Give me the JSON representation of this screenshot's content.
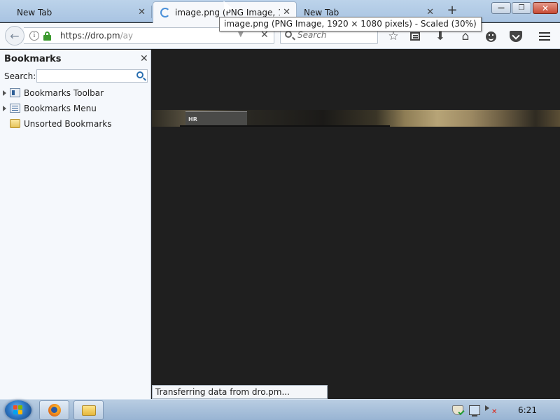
{
  "tabs": [
    {
      "label": "New Tab",
      "active": false
    },
    {
      "label": "image.png (PNG Image, 1...",
      "active": true,
      "loading": true
    },
    {
      "label": "New Tab",
      "active": false
    }
  ],
  "tab_close_glyph": "✕",
  "new_tab_glyph": "+",
  "window_controls": {
    "minimize": "—",
    "maximize": "❐",
    "close": "✕"
  },
  "tooltip": "image.png (PNG Image, 1920 × 1080 pixels) - Scaled (30%)",
  "navbar": {
    "url_host": "https://dro.pm",
    "url_path": "/ay",
    "search_placeholder": "Search",
    "back_glyph": "←",
    "stop_glyph": "✕",
    "dropdown_glyph": "▼",
    "star_glyph": "☆",
    "download_glyph": "⬇",
    "home_glyph": "⌂"
  },
  "sidebar": {
    "title": "Bookmarks",
    "close_glyph": "✕",
    "search_label": "Search:",
    "search_value": "",
    "items": [
      {
        "label": "Bookmarks Toolbar",
        "icon": "bookmarks-toolbar-icon",
        "expandable": true
      },
      {
        "label": "Bookmarks Menu",
        "icon": "bookmarks-menu-icon",
        "expandable": true
      },
      {
        "label": "Unsorted Bookmarks",
        "icon": "unsorted-bookmarks-icon",
        "expandable": false
      }
    ]
  },
  "content": {
    "image_overlay_label": "HR"
  },
  "status": "Transferring data from dro.pm...",
  "taskbar": {
    "clock": "6:21",
    "apps": [
      "firefox-icon",
      "windows-explorer-icon"
    ]
  },
  "colors": {
    "tabstrip": "#bcd3ea",
    "navbar": "#f6f8fb",
    "content_bg": "#1f1f1f",
    "secure_lock": "#3b9a2e"
  }
}
